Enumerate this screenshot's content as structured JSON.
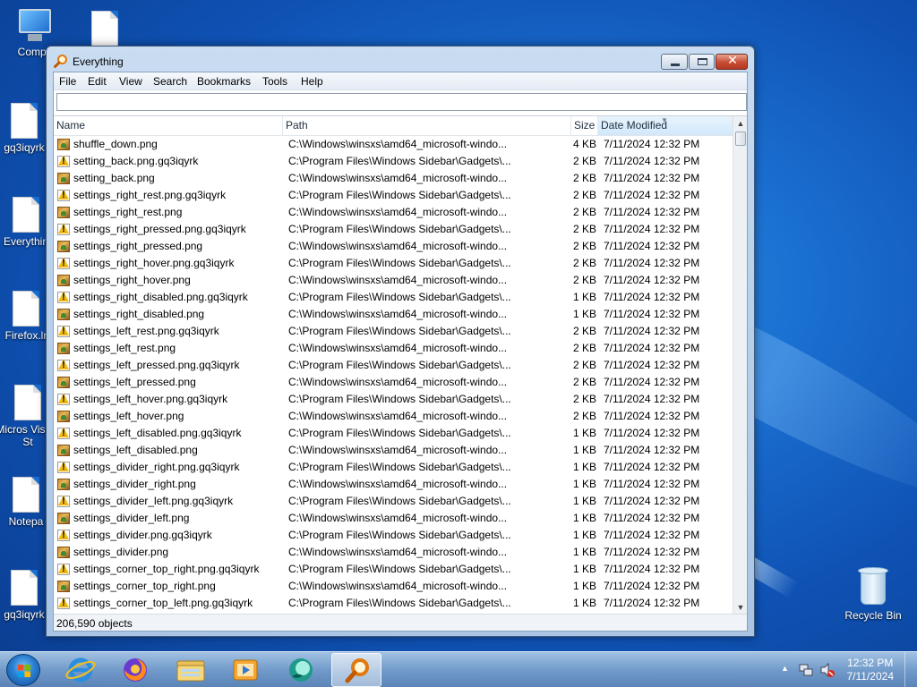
{
  "desktop": {
    "icons": [
      {
        "label": "Compu"
      },
      {
        "label": ""
      },
      {
        "label": "gq3iqyrk"
      },
      {
        "label": "Everythin"
      },
      {
        "label": "Firefox.lr"
      },
      {
        "label": "Micros Visual St"
      },
      {
        "label": "Notepa"
      },
      {
        "label": "gq3iqyrk"
      },
      {
        "label": "Recycle Bin"
      }
    ]
  },
  "window": {
    "title": "Everything",
    "menu": [
      "File",
      "Edit",
      "View",
      "Search",
      "Bookmarks",
      "Tools",
      "Help"
    ],
    "search": {
      "value": "",
      "placeholder": ""
    },
    "columns": {
      "name": "Name",
      "path": "Path",
      "size": "Size",
      "date": "Date Modified"
    },
    "rows": [
      {
        "icon": "png",
        "name": "shuffle_down.png",
        "path": "C:\\Windows\\winsxs\\amd64_microsoft-windo...",
        "size": "4 KB",
        "date": "7/11/2024 12:32 PM"
      },
      {
        "icon": "warn",
        "name": "setting_back.png.gq3iqyrk",
        "path": "C:\\Program Files\\Windows Sidebar\\Gadgets\\...",
        "size": "2 KB",
        "date": "7/11/2024 12:32 PM"
      },
      {
        "icon": "png",
        "name": "setting_back.png",
        "path": "C:\\Windows\\winsxs\\amd64_microsoft-windo...",
        "size": "2 KB",
        "date": "7/11/2024 12:32 PM"
      },
      {
        "icon": "warn",
        "name": "settings_right_rest.png.gq3iqyrk",
        "path": "C:\\Program Files\\Windows Sidebar\\Gadgets\\...",
        "size": "2 KB",
        "date": "7/11/2024 12:32 PM"
      },
      {
        "icon": "png",
        "name": "settings_right_rest.png",
        "path": "C:\\Windows\\winsxs\\amd64_microsoft-windo...",
        "size": "2 KB",
        "date": "7/11/2024 12:32 PM"
      },
      {
        "icon": "warn",
        "name": "settings_right_pressed.png.gq3iqyrk",
        "path": "C:\\Program Files\\Windows Sidebar\\Gadgets\\...",
        "size": "2 KB",
        "date": "7/11/2024 12:32 PM"
      },
      {
        "icon": "png",
        "name": "settings_right_pressed.png",
        "path": "C:\\Windows\\winsxs\\amd64_microsoft-windo...",
        "size": "2 KB",
        "date": "7/11/2024 12:32 PM"
      },
      {
        "icon": "warn",
        "name": "settings_right_hover.png.gq3iqyrk",
        "path": "C:\\Program Files\\Windows Sidebar\\Gadgets\\...",
        "size": "2 KB",
        "date": "7/11/2024 12:32 PM"
      },
      {
        "icon": "png",
        "name": "settings_right_hover.png",
        "path": "C:\\Windows\\winsxs\\amd64_microsoft-windo...",
        "size": "2 KB",
        "date": "7/11/2024 12:32 PM"
      },
      {
        "icon": "warn",
        "name": "settings_right_disabled.png.gq3iqyrk",
        "path": "C:\\Program Files\\Windows Sidebar\\Gadgets\\...",
        "size": "1 KB",
        "date": "7/11/2024 12:32 PM"
      },
      {
        "icon": "png",
        "name": "settings_right_disabled.png",
        "path": "C:\\Windows\\winsxs\\amd64_microsoft-windo...",
        "size": "1 KB",
        "date": "7/11/2024 12:32 PM"
      },
      {
        "icon": "warn",
        "name": "settings_left_rest.png.gq3iqyrk",
        "path": "C:\\Program Files\\Windows Sidebar\\Gadgets\\...",
        "size": "2 KB",
        "date": "7/11/2024 12:32 PM"
      },
      {
        "icon": "png",
        "name": "settings_left_rest.png",
        "path": "C:\\Windows\\winsxs\\amd64_microsoft-windo...",
        "size": "2 KB",
        "date": "7/11/2024 12:32 PM"
      },
      {
        "icon": "warn",
        "name": "settings_left_pressed.png.gq3iqyrk",
        "path": "C:\\Program Files\\Windows Sidebar\\Gadgets\\...",
        "size": "2 KB",
        "date": "7/11/2024 12:32 PM"
      },
      {
        "icon": "png",
        "name": "settings_left_pressed.png",
        "path": "C:\\Windows\\winsxs\\amd64_microsoft-windo...",
        "size": "2 KB",
        "date": "7/11/2024 12:32 PM"
      },
      {
        "icon": "warn",
        "name": "settings_left_hover.png.gq3iqyrk",
        "path": "C:\\Program Files\\Windows Sidebar\\Gadgets\\...",
        "size": "2 KB",
        "date": "7/11/2024 12:32 PM"
      },
      {
        "icon": "png",
        "name": "settings_left_hover.png",
        "path": "C:\\Windows\\winsxs\\amd64_microsoft-windo...",
        "size": "2 KB",
        "date": "7/11/2024 12:32 PM"
      },
      {
        "icon": "warn",
        "name": "settings_left_disabled.png.gq3iqyrk",
        "path": "C:\\Program Files\\Windows Sidebar\\Gadgets\\...",
        "size": "1 KB",
        "date": "7/11/2024 12:32 PM"
      },
      {
        "icon": "png",
        "name": "settings_left_disabled.png",
        "path": "C:\\Windows\\winsxs\\amd64_microsoft-windo...",
        "size": "1 KB",
        "date": "7/11/2024 12:32 PM"
      },
      {
        "icon": "warn",
        "name": "settings_divider_right.png.gq3iqyrk",
        "path": "C:\\Program Files\\Windows Sidebar\\Gadgets\\...",
        "size": "1 KB",
        "date": "7/11/2024 12:32 PM"
      },
      {
        "icon": "png",
        "name": "settings_divider_right.png",
        "path": "C:\\Windows\\winsxs\\amd64_microsoft-windo...",
        "size": "1 KB",
        "date": "7/11/2024 12:32 PM"
      },
      {
        "icon": "warn",
        "name": "settings_divider_left.png.gq3iqyrk",
        "path": "C:\\Program Files\\Windows Sidebar\\Gadgets\\...",
        "size": "1 KB",
        "date": "7/11/2024 12:32 PM"
      },
      {
        "icon": "png",
        "name": "settings_divider_left.png",
        "path": "C:\\Windows\\winsxs\\amd64_microsoft-windo...",
        "size": "1 KB",
        "date": "7/11/2024 12:32 PM"
      },
      {
        "icon": "warn",
        "name": "settings_divider.png.gq3iqyrk",
        "path": "C:\\Program Files\\Windows Sidebar\\Gadgets\\...",
        "size": "1 KB",
        "date": "7/11/2024 12:32 PM"
      },
      {
        "icon": "png",
        "name": "settings_divider.png",
        "path": "C:\\Windows\\winsxs\\amd64_microsoft-windo...",
        "size": "1 KB",
        "date": "7/11/2024 12:32 PM"
      },
      {
        "icon": "warn",
        "name": "settings_corner_top_right.png.gq3iqyrk",
        "path": "C:\\Program Files\\Windows Sidebar\\Gadgets\\...",
        "size": "1 KB",
        "date": "7/11/2024 12:32 PM"
      },
      {
        "icon": "png",
        "name": "settings_corner_top_right.png",
        "path": "C:\\Windows\\winsxs\\amd64_microsoft-windo...",
        "size": "1 KB",
        "date": "7/11/2024 12:32 PM"
      },
      {
        "icon": "warn",
        "name": "settings_corner_top_left.png.gq3iqyrk",
        "path": "C:\\Program Files\\Windows Sidebar\\Gadgets\\...",
        "size": "1 KB",
        "date": "7/11/2024 12:32 PM"
      }
    ],
    "status": "206,590 objects"
  },
  "taskbar": {
    "items": [
      {
        "icon": "internet-explorer-icon"
      },
      {
        "icon": "firefox-icon"
      },
      {
        "icon": "file-explorer-icon"
      },
      {
        "icon": "media-player-icon"
      },
      {
        "icon": "app-circle-icon"
      },
      {
        "icon": "everything-search-icon",
        "active": true
      }
    ],
    "clock_time": "12:32 PM",
    "clock_date": "7/11/2024"
  },
  "colors": {
    "accent": "#1a6fd0",
    "sorted_header": "#d1e8fa",
    "close_button": "#c74c33"
  }
}
